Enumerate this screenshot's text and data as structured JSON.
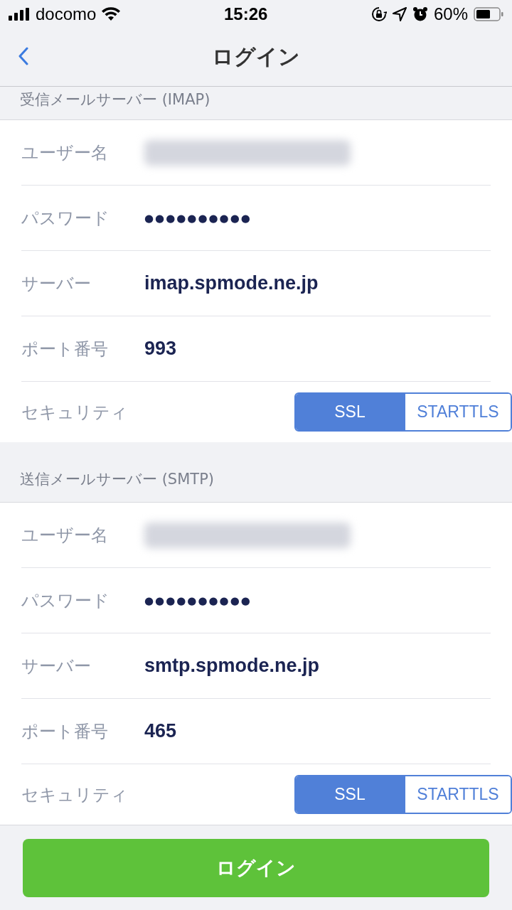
{
  "status_bar": {
    "carrier": "docomo",
    "time": "15:26",
    "battery": "60%"
  },
  "nav": {
    "title": "ログイン"
  },
  "sections": [
    {
      "header": "受信メールサーバー (IMAP)",
      "rows": [
        {
          "kind": "redacted",
          "label": "ユーザー名"
        },
        {
          "kind": "password",
          "label": "パスワード",
          "value": "●●●●●●●●●●"
        },
        {
          "kind": "text",
          "label": "サーバー",
          "value": "imap.spmode.ne.jp"
        },
        {
          "kind": "text",
          "label": "ポート番号",
          "value": "993"
        },
        {
          "kind": "segmented",
          "label": "セキュリティ",
          "options": [
            {
              "label": "SSL",
              "selected": true
            },
            {
              "label": "STARTTLS",
              "selected": false
            }
          ]
        }
      ]
    },
    {
      "header": "送信メールサーバー (SMTP)",
      "rows": [
        {
          "kind": "redacted",
          "label": "ユーザー名"
        },
        {
          "kind": "password",
          "label": "パスワード",
          "value": "●●●●●●●●●●"
        },
        {
          "kind": "text",
          "label": "サーバー",
          "value": "smtp.spmode.ne.jp"
        },
        {
          "kind": "text",
          "label": "ポート番号",
          "value": "465"
        },
        {
          "kind": "segmented",
          "label": "セキュリティ",
          "options": [
            {
              "label": "SSL",
              "selected": true
            },
            {
              "label": "STARTTLS",
              "selected": false
            }
          ]
        }
      ]
    }
  ],
  "login_button": "ログイン"
}
